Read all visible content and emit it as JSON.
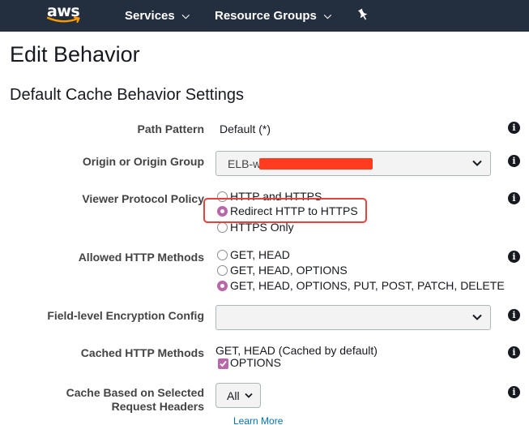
{
  "header": {
    "logo": "aws",
    "nav": [
      {
        "label": "Services"
      },
      {
        "label": "Resource Groups"
      }
    ],
    "pin_icon": "pushpin-icon"
  },
  "page": {
    "title": "Edit Behavior",
    "section_title": "Default Cache Behavior Settings"
  },
  "form": {
    "path_pattern": {
      "label": "Path Pattern",
      "value": "Default (*)"
    },
    "origin": {
      "label": "Origin or Origin Group",
      "value": "ELB-w",
      "redacted": true
    },
    "viewer_protocol": {
      "label": "Viewer Protocol Policy",
      "options": [
        {
          "label": "HTTP and HTTPS",
          "selected": false
        },
        {
          "label": "Redirect HTTP to HTTPS",
          "selected": true
        },
        {
          "label": "HTTPS Only",
          "selected": false
        }
      ]
    },
    "allowed_methods": {
      "label": "Allowed HTTP Methods",
      "options": [
        {
          "label": "GET, HEAD",
          "selected": false
        },
        {
          "label": "GET, HEAD, OPTIONS",
          "selected": false
        },
        {
          "label": "GET, HEAD, OPTIONS, PUT, POST, PATCH, DELETE",
          "selected": true
        }
      ]
    },
    "field_level_encryption": {
      "label": "Field-level Encryption Config",
      "value": ""
    },
    "cached_methods": {
      "label": "Cached HTTP Methods",
      "static_text": "GET, HEAD (Cached by default)",
      "checkbox_label": "OPTIONS",
      "checkbox_checked": true
    },
    "cache_headers": {
      "label_line1": "Cache Based on Selected",
      "label_line2": "Request Headers",
      "value": "All",
      "link": "Learn More"
    }
  },
  "colors": {
    "topbar": "#232f3e",
    "accent_radio": "#b867a8",
    "highlight_border": "#e8403b",
    "redaction": "#ff3b1f",
    "link": "#0073bb"
  }
}
